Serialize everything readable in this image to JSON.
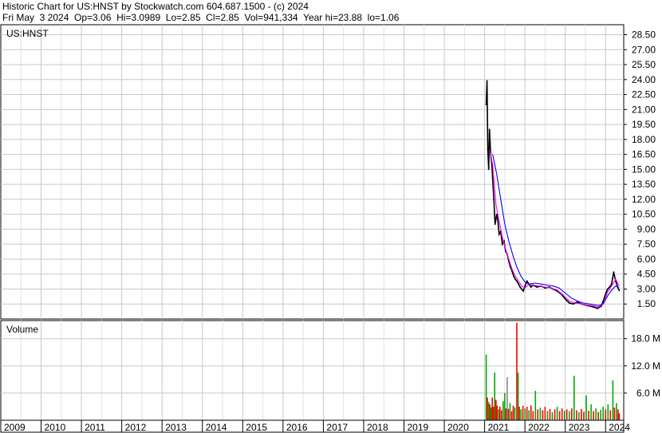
{
  "header": {
    "line1": "Historic Chart for US:HNST by Stockwatch.com 604.687.1500 - (c) 2024",
    "line2": "Fri May  3 2024  Op=3.06  Hi=3.0989  Lo=2.85  Cl=2.85  Vol=941,334  Year hi=23.88  lo=1.06"
  },
  "chart_data": [
    {
      "type": "line",
      "title": "US:HNST",
      "y_ticks": [
        "28.50",
        "27.00",
        "25.50",
        "24.00",
        "22.50",
        "21.00",
        "19.50",
        "18.00",
        "16.50",
        "15.00",
        "13.50",
        "12.00",
        "10.50",
        "9.00",
        "7.50",
        "6.00",
        "4.50",
        "3.00",
        "1.50"
      ],
      "ylim": [
        0,
        29.5
      ],
      "x_ticks": [
        "2009",
        "2010",
        "2011",
        "2012",
        "2013",
        "2014",
        "2015",
        "2016",
        "2017",
        "2018",
        "2019",
        "2020",
        "2021",
        "2022",
        "2023",
        "2024"
      ],
      "xlim": [
        2009.0,
        2024.45
      ],
      "grid": true,
      "series": [
        {
          "color": "#000000",
          "x": [
            2021.04,
            2021.06,
            2021.08,
            2021.1,
            2021.12,
            2021.15,
            2021.18,
            2021.2,
            2021.23,
            2021.26,
            2021.3,
            2021.33,
            2021.36,
            2021.4,
            2021.44,
            2021.48,
            2021.52,
            2021.56,
            2021.6,
            2021.64,
            2021.68,
            2021.72,
            2021.76,
            2021.8,
            2021.84,
            2021.88,
            2021.92,
            2021.96,
            2022.0,
            2022.05,
            2022.1,
            2022.15,
            2022.2,
            2022.3,
            2022.4,
            2022.5,
            2022.6,
            2022.7,
            2022.8,
            2022.9,
            2023.0,
            2023.1,
            2023.2,
            2023.3,
            2023.4,
            2023.5,
            2023.6,
            2023.7,
            2023.8,
            2023.9,
            2024.0,
            2024.05,
            2024.1,
            2024.15,
            2024.2,
            2024.25,
            2024.3,
            2024.34
          ],
          "values": [
            21.5,
            23.88,
            17.0,
            15.0,
            19.0,
            16.5,
            15.5,
            14.0,
            12.0,
            9.5,
            10.5,
            9.8,
            8.5,
            8.8,
            7.5,
            7.8,
            6.8,
            6.5,
            5.8,
            5.2,
            4.8,
            4.3,
            4.0,
            3.8,
            3.5,
            3.2,
            3.0,
            2.8,
            3.3,
            3.8,
            3.5,
            3.2,
            3.4,
            3.2,
            3.3,
            3.1,
            3.2,
            3.0,
            2.8,
            2.5,
            2.0,
            1.6,
            1.5,
            1.7,
            1.5,
            1.4,
            1.3,
            1.2,
            1.06,
            1.3,
            2.5,
            3.0,
            3.2,
            3.5,
            4.7,
            3.8,
            3.2,
            2.85
          ]
        },
        {
          "color": "#ff00ff",
          "x": [
            2021.12,
            2021.2,
            2021.28,
            2021.36,
            2021.44,
            2021.52,
            2021.6,
            2021.68,
            2021.76,
            2021.84,
            2021.92,
            2022.0,
            2022.1,
            2022.2,
            2022.35,
            2022.5,
            2022.65,
            2022.8,
            2022.95,
            2023.1,
            2023.25,
            2023.4,
            2023.55,
            2023.7,
            2023.82,
            2023.95,
            2024.05,
            2024.15,
            2024.25,
            2024.34
          ],
          "values": [
            17.0,
            15.5,
            11.5,
            9.8,
            8.2,
            7.0,
            6.0,
            5.0,
            4.3,
            3.8,
            3.3,
            3.1,
            3.5,
            3.4,
            3.3,
            3.2,
            3.1,
            2.9,
            2.4,
            1.8,
            1.6,
            1.5,
            1.4,
            1.3,
            1.2,
            1.5,
            2.7,
            3.3,
            4.0,
            3.3
          ]
        },
        {
          "color": "#0000ff",
          "x": [
            2021.2,
            2021.3,
            2021.4,
            2021.5,
            2021.6,
            2021.7,
            2021.8,
            2021.9,
            2022.0,
            2022.1,
            2022.25,
            2022.4,
            2022.55,
            2022.7,
            2022.85,
            2023.0,
            2023.15,
            2023.3,
            2023.45,
            2023.6,
            2023.75,
            2023.85,
            2023.95,
            2024.05,
            2024.15,
            2024.25,
            2024.34
          ],
          "values": [
            16.5,
            14.5,
            12.0,
            9.5,
            7.8,
            6.4,
            5.2,
            4.3,
            3.7,
            3.5,
            3.6,
            3.5,
            3.4,
            3.3,
            3.1,
            2.6,
            2.1,
            1.8,
            1.6,
            1.5,
            1.4,
            1.35,
            1.6,
            2.3,
            2.9,
            3.3,
            3.1
          ]
        }
      ]
    },
    {
      "type": "bar",
      "title": "Volume",
      "y_ticks": [
        "18.0 M",
        "12.0 M",
        "6.0 M"
      ],
      "ylim": [
        0,
        22
      ],
      "xlim": [
        2009.0,
        2024.45
      ],
      "grid": true,
      "bars": [
        {
          "x": 2021.04,
          "v": 14.5,
          "color": "#00aa00"
        },
        {
          "x": 2021.07,
          "v": 5.0,
          "color": "#ff0000"
        },
        {
          "x": 2021.1,
          "v": 4.0,
          "color": "#00aa00"
        },
        {
          "x": 2021.13,
          "v": 3.5,
          "color": "#ff0000"
        },
        {
          "x": 2021.16,
          "v": 2.8,
          "color": "#00aa00"
        },
        {
          "x": 2021.19,
          "v": 5.0,
          "color": "#ff0000"
        },
        {
          "x": 2021.22,
          "v": 3.0,
          "color": "#ff0000"
        },
        {
          "x": 2021.25,
          "v": 10.5,
          "color": "#00aa00"
        },
        {
          "x": 2021.28,
          "v": 4.5,
          "color": "#ff0000"
        },
        {
          "x": 2021.31,
          "v": 3.2,
          "color": "#ff0000"
        },
        {
          "x": 2021.35,
          "v": 2.4,
          "color": "#00aa00"
        },
        {
          "x": 2021.38,
          "v": 3.0,
          "color": "#ff0000"
        },
        {
          "x": 2021.42,
          "v": 2.2,
          "color": "#ff0000"
        },
        {
          "x": 2021.46,
          "v": 4.2,
          "color": "#00aa00"
        },
        {
          "x": 2021.5,
          "v": 6.0,
          "color": "#00aa00"
        },
        {
          "x": 2021.53,
          "v": 2.6,
          "color": "#ff0000"
        },
        {
          "x": 2021.56,
          "v": 9.5,
          "color": "#888888"
        },
        {
          "x": 2021.59,
          "v": 2.5,
          "color": "#ff0000"
        },
        {
          "x": 2021.63,
          "v": 3.8,
          "color": "#00aa00"
        },
        {
          "x": 2021.67,
          "v": 2.0,
          "color": "#ff0000"
        },
        {
          "x": 2021.71,
          "v": 3.2,
          "color": "#ff0000"
        },
        {
          "x": 2021.75,
          "v": 2.8,
          "color": "#00aa00"
        },
        {
          "x": 2021.8,
          "v": 21.5,
          "color": "#ff0000"
        },
        {
          "x": 2021.83,
          "v": 10.5,
          "color": "#00aa00"
        },
        {
          "x": 2021.86,
          "v": 3.0,
          "color": "#ff0000"
        },
        {
          "x": 2021.9,
          "v": 2.4,
          "color": "#00aa00"
        },
        {
          "x": 2021.95,
          "v": 3.2,
          "color": "#ff0000"
        },
        {
          "x": 2022.0,
          "v": 2.6,
          "color": "#00aa00"
        },
        {
          "x": 2022.05,
          "v": 3.0,
          "color": "#ff0000"
        },
        {
          "x": 2022.1,
          "v": 2.2,
          "color": "#00aa00"
        },
        {
          "x": 2022.15,
          "v": 3.3,
          "color": "#ff0000"
        },
        {
          "x": 2022.2,
          "v": 2.0,
          "color": "#ff0000"
        },
        {
          "x": 2022.26,
          "v": 6.5,
          "color": "#00aa00"
        },
        {
          "x": 2022.32,
          "v": 2.4,
          "color": "#ff0000"
        },
        {
          "x": 2022.38,
          "v": 2.8,
          "color": "#00aa00"
        },
        {
          "x": 2022.44,
          "v": 2.2,
          "color": "#ff0000"
        },
        {
          "x": 2022.5,
          "v": 3.0,
          "color": "#ff0000"
        },
        {
          "x": 2022.56,
          "v": 2.0,
          "color": "#00aa00"
        },
        {
          "x": 2022.62,
          "v": 2.5,
          "color": "#ff0000"
        },
        {
          "x": 2022.68,
          "v": 1.8,
          "color": "#00aa00"
        },
        {
          "x": 2022.74,
          "v": 2.4,
          "color": "#ff0000"
        },
        {
          "x": 2022.8,
          "v": 3.0,
          "color": "#00aa00"
        },
        {
          "x": 2022.86,
          "v": 2.0,
          "color": "#ff0000"
        },
        {
          "x": 2022.92,
          "v": 2.6,
          "color": "#ff0000"
        },
        {
          "x": 2022.98,
          "v": 2.1,
          "color": "#00aa00"
        },
        {
          "x": 2023.04,
          "v": 2.4,
          "color": "#ff0000"
        },
        {
          "x": 2023.1,
          "v": 2.0,
          "color": "#00aa00"
        },
        {
          "x": 2023.16,
          "v": 2.6,
          "color": "#ff0000"
        },
        {
          "x": 2023.22,
          "v": 9.8,
          "color": "#00aa00"
        },
        {
          "x": 2023.28,
          "v": 2.2,
          "color": "#ff0000"
        },
        {
          "x": 2023.34,
          "v": 1.8,
          "color": "#00aa00"
        },
        {
          "x": 2023.4,
          "v": 2.5,
          "color": "#ff0000"
        },
        {
          "x": 2023.46,
          "v": 1.9,
          "color": "#ff0000"
        },
        {
          "x": 2023.52,
          "v": 5.5,
          "color": "#00aa00"
        },
        {
          "x": 2023.58,
          "v": 2.1,
          "color": "#ff0000"
        },
        {
          "x": 2023.64,
          "v": 3.5,
          "color": "#00aa00"
        },
        {
          "x": 2023.7,
          "v": 2.0,
          "color": "#ff0000"
        },
        {
          "x": 2023.76,
          "v": 2.6,
          "color": "#00aa00"
        },
        {
          "x": 2023.82,
          "v": 1.8,
          "color": "#ff0000"
        },
        {
          "x": 2023.88,
          "v": 2.3,
          "color": "#00aa00"
        },
        {
          "x": 2023.94,
          "v": 3.0,
          "color": "#00aa00"
        },
        {
          "x": 2024.0,
          "v": 2.4,
          "color": "#ff0000"
        },
        {
          "x": 2024.06,
          "v": 3.5,
          "color": "#00aa00"
        },
        {
          "x": 2024.12,
          "v": 2.2,
          "color": "#ff0000"
        },
        {
          "x": 2024.18,
          "v": 8.8,
          "color": "#00aa00"
        },
        {
          "x": 2024.22,
          "v": 2.8,
          "color": "#ff0000"
        },
        {
          "x": 2024.27,
          "v": 3.8,
          "color": "#00aa00"
        },
        {
          "x": 2024.31,
          "v": 2.4,
          "color": "#ff0000"
        },
        {
          "x": 2024.34,
          "v": 1.5,
          "color": "#ff0000"
        }
      ]
    }
  ]
}
